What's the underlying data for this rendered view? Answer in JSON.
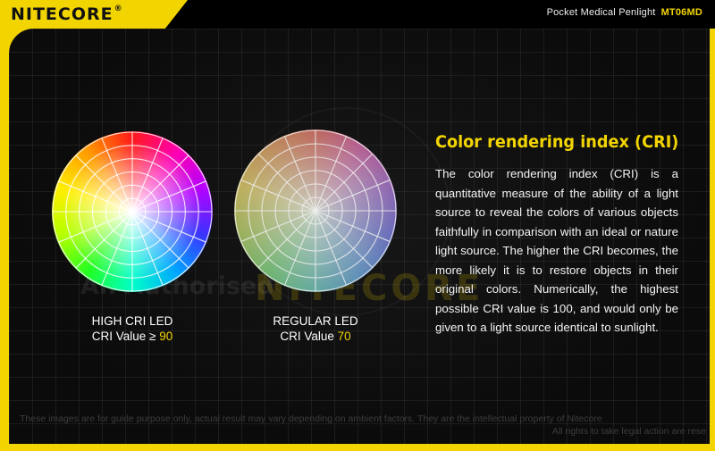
{
  "header": {
    "brand": "NITECORE",
    "brand_mark": "®",
    "product_name": "Pocket Medical Penlight",
    "model": "MT06MD"
  },
  "wheels": {
    "high": {
      "title": "HIGH CRI LED",
      "value_label": "CRI Value ≥ ",
      "value": "90"
    },
    "regular": {
      "title": "REGULAR LED",
      "value_label": "CRI Value ",
      "value": "70"
    }
  },
  "article": {
    "heading": "Color rendering index (CRI)",
    "body": "The color rendering index (CRI) is a quantitative measure of the ability of a light source to reveal the colors of various objects faithfully in comparison with an ideal or nature light source. The higher the CRI becomes, the more likely it is to restore objects in their original colors. Numerically, the highest possible CRI value is 100, and would only be given to a light source identical to sunlight."
  },
  "watermark": {
    "text": "An Authorised",
    "brand": "NITECORE"
  },
  "footer": {
    "disclaimer": "These images are for guide purpose only, actual result may vary depending on ambient factors. They are the intellectual property of Nitecore",
    "rights": "All rights to take legal action are rese"
  },
  "colors": {
    "accent": "#f2d500",
    "background": "#0b0b0b"
  }
}
